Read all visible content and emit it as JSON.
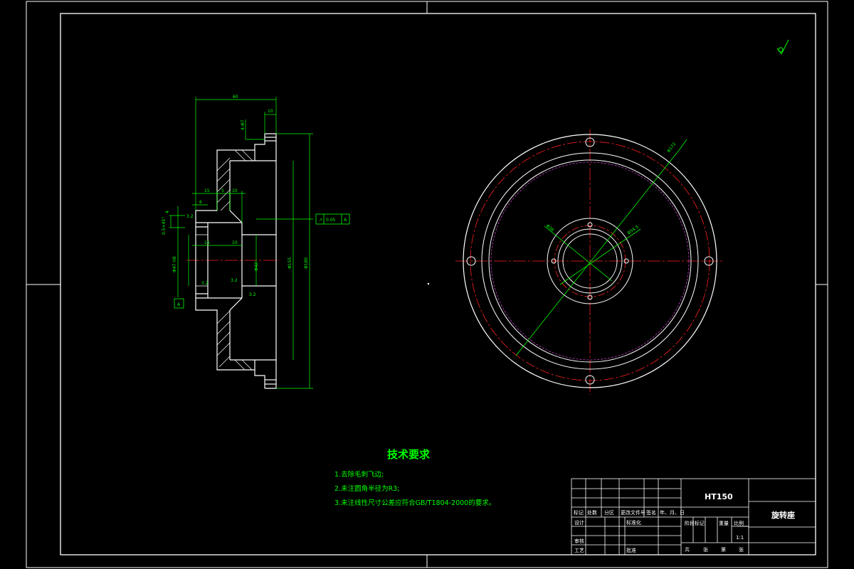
{
  "tech": {
    "title": "技术要求",
    "items": [
      "1.去除毛刺飞边;",
      "2.未注圆角半径为R3;",
      "3.未注线性尺寸公差应符合GB/T1804-2000的要求。"
    ]
  },
  "section_dims": {
    "overall_width": "60",
    "flange_width": "10",
    "hole_pattern": "4-Φ7",
    "hub_15_top": "15",
    "hub_5": "5",
    "hub_10_top": "10",
    "hub_6": "6",
    "inner_15": "15",
    "inner_10": "10",
    "diam_155": "Φ155",
    "diam_180": "Φ180",
    "bore_left": "Φ47 H8",
    "bore_right": "Φ42",
    "roughness_a": "3.2",
    "roughness_b": "3.2",
    "roughness_c": "3.2",
    "roughness_d": "3.2",
    "small_4": "4",
    "chamfer": "0.5×45°",
    "datum": "A",
    "tolerance_symbol": "↗",
    "tolerance_value": "0.05",
    "tolerance_datum": "A"
  },
  "front_dims": {
    "pcd_large": "Φ172",
    "pcd_small": "Φ54.5",
    "bore": "Φ36"
  },
  "title_block": {
    "material": "HT150",
    "part_name": "旋转座",
    "scale": "1:1",
    "hdr": [
      "标记",
      "处数",
      "分区",
      "更改文件号",
      "签名",
      "年、月、日"
    ],
    "rows_left": [
      "设计",
      "审核",
      "工艺"
    ],
    "standardize": "标准化",
    "approve": "批准",
    "stage_mark": "阶段标记",
    "weight": "重量",
    "scale_label": "比例",
    "sheet_row": [
      "共",
      "张",
      "第",
      "张"
    ]
  },
  "colors": {
    "outline": "#ffffff",
    "dimension": "#00ff00",
    "centerline": "#ff2020",
    "hidden": "#c040c0",
    "background": "#000000"
  }
}
